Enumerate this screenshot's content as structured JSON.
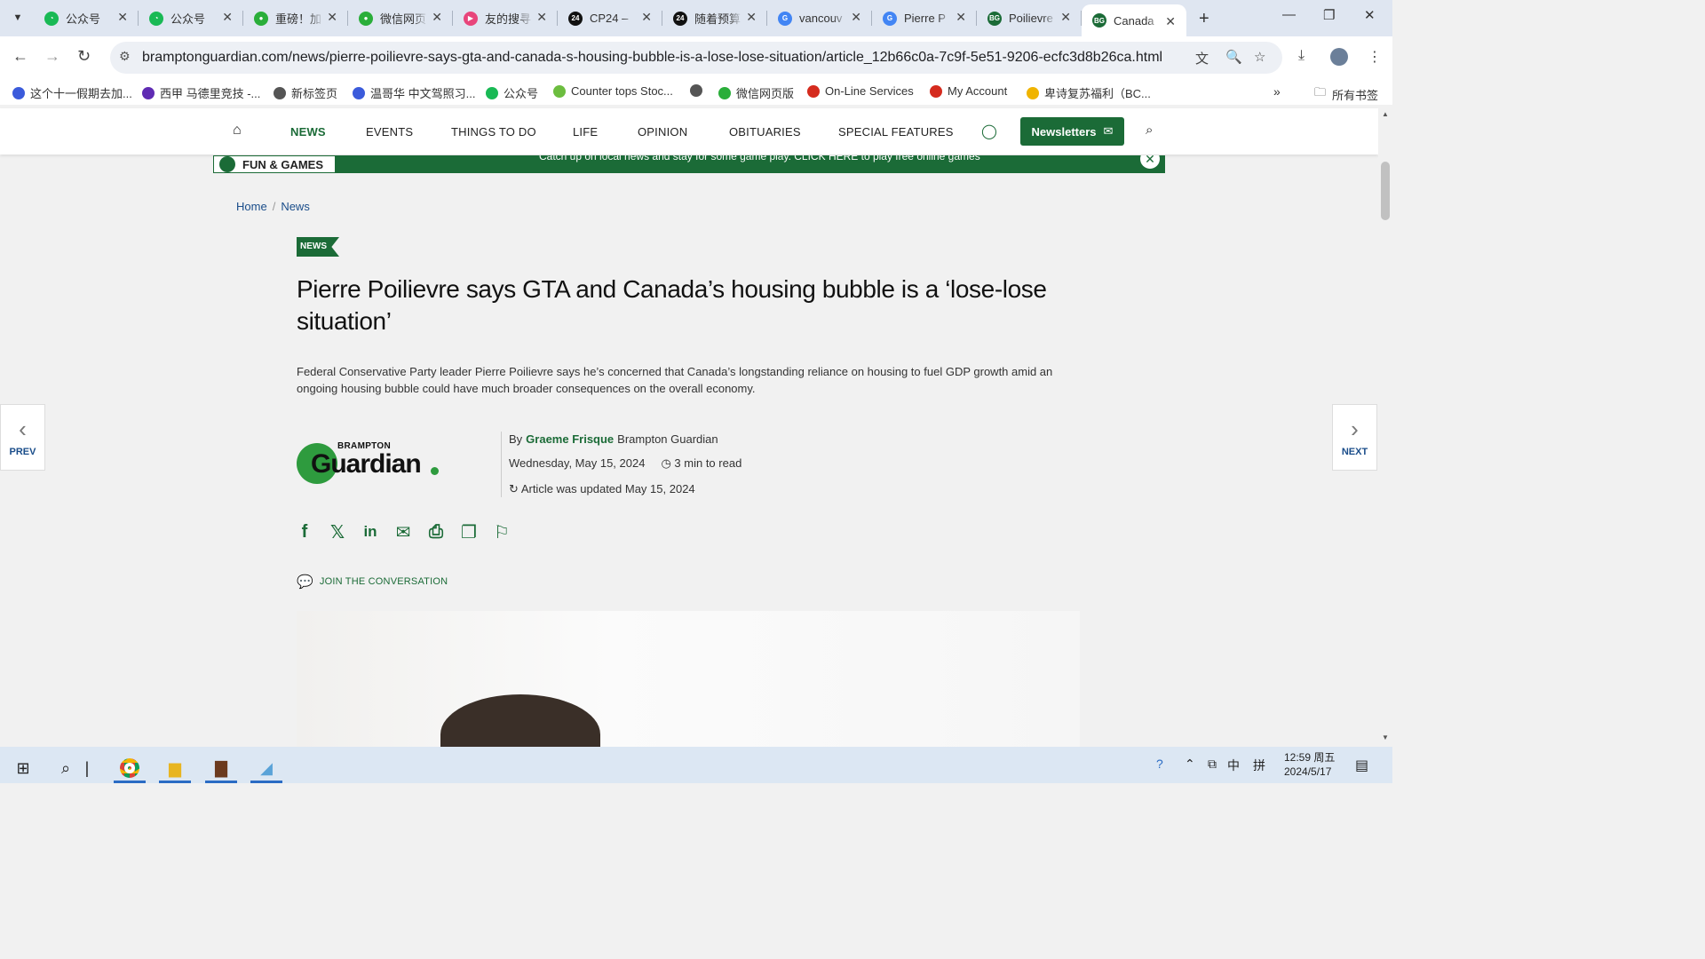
{
  "browser": {
    "tabs": [
      {
        "title": "公众号",
        "color": "#19b955",
        "glyph": "◔"
      },
      {
        "title": "公众号",
        "color": "#19b955",
        "glyph": "◔"
      },
      {
        "title": "重磅！加",
        "color": "#2aae3a",
        "glyph": "●"
      },
      {
        "title": "微信网页",
        "color": "#2aae3a",
        "glyph": "●"
      },
      {
        "title": "友的搜寻",
        "color": "#e8457b",
        "glyph": "▶"
      },
      {
        "title": "CP24 –",
        "color": "#111111",
        "glyph": "24"
      },
      {
        "title": "随着预算",
        "color": "#111111",
        "glyph": "24"
      },
      {
        "title": "vancouv",
        "color": "#4285f4",
        "glyph": "G"
      },
      {
        "title": "Pierre P",
        "color": "#4285f4",
        "glyph": "G"
      },
      {
        "title": "Poilievre",
        "color": "#1b6b37",
        "glyph": "BG"
      },
      {
        "title": "Canada",
        "color": "#1b6b37",
        "glyph": "BG"
      }
    ],
    "url": "bramptonguardian.com/news/pierre-poilievre-says-gta-and-canada-s-housing-bubble-is-a-lose-lose-situation/article_12b66c0a-7c9f-5e51-9206-ecfc3d8b26ca.html",
    "bookmarks": [
      {
        "label": "这个十一假期去加...",
        "color": "#3b5bdb"
      },
      {
        "label": "西甲 马德里竞技 -...",
        "color": "#5f2bb3"
      },
      {
        "label": "新标签页",
        "color": "#555555"
      },
      {
        "label": "温哥华 中文驾照习...",
        "color": "#3b5bdb"
      },
      {
        "label": "公众号",
        "color": "#19b955"
      },
      {
        "label": "Counter tops Stoc...",
        "color": "#6cbd3f"
      },
      {
        "label": "",
        "color": "#555555"
      },
      {
        "label": "微信网页版",
        "color": "#2aae3a"
      },
      {
        "label": "On-Line Services",
        "color": "#d52b1e"
      },
      {
        "label": "My Account",
        "color": "#d52b1e"
      },
      {
        "label": "卑诗复苏福利（BC...",
        "color": "#f0b400"
      }
    ],
    "all_bookmarks": "所有书签"
  },
  "site": {
    "nav": [
      "NEWS",
      "EVENTS",
      "THINGS TO DO",
      "LIFE",
      "OPINION",
      "OBITUARIES",
      "SPECIAL FEATURES"
    ],
    "newsletters": "Newsletters",
    "promo_label": "FUN & GAMES",
    "promo_text": "Catch up on local news and stay for some game play. CLICK HERE to play free online games",
    "brand_color": "#1b6b37"
  },
  "breadcrumb": [
    "Home",
    "News"
  ],
  "article": {
    "section": "NEWS",
    "headline": "Pierre Poilievre says GTA and Canada’s housing bubble is a ‘lose-lose situation’",
    "dek": "Federal Conservative Party leader Pierre Poilievre says he’s concerned that Canada’s longstanding reliance on housing to fuel GDP growth amid an ongoing housing bubble could have much broader consequences on the overall economy.",
    "logo_small": "BRAMPTON",
    "logo_big": "Guardian",
    "by": "By",
    "author": "Graeme Frisque",
    "publication": "Brampton Guardian",
    "date": "Wednesday, May 15, 2024",
    "read_time": "3 min to read",
    "updated": "Article was updated May 15, 2024",
    "join": "JOIN THE CONVERSATION"
  },
  "pager": {
    "prev": "PREV",
    "next": "NEXT"
  },
  "taskbar": {
    "time": "12:59 周五",
    "date": "2024/5/17",
    "ime1": "中",
    "ime2": "拼"
  }
}
